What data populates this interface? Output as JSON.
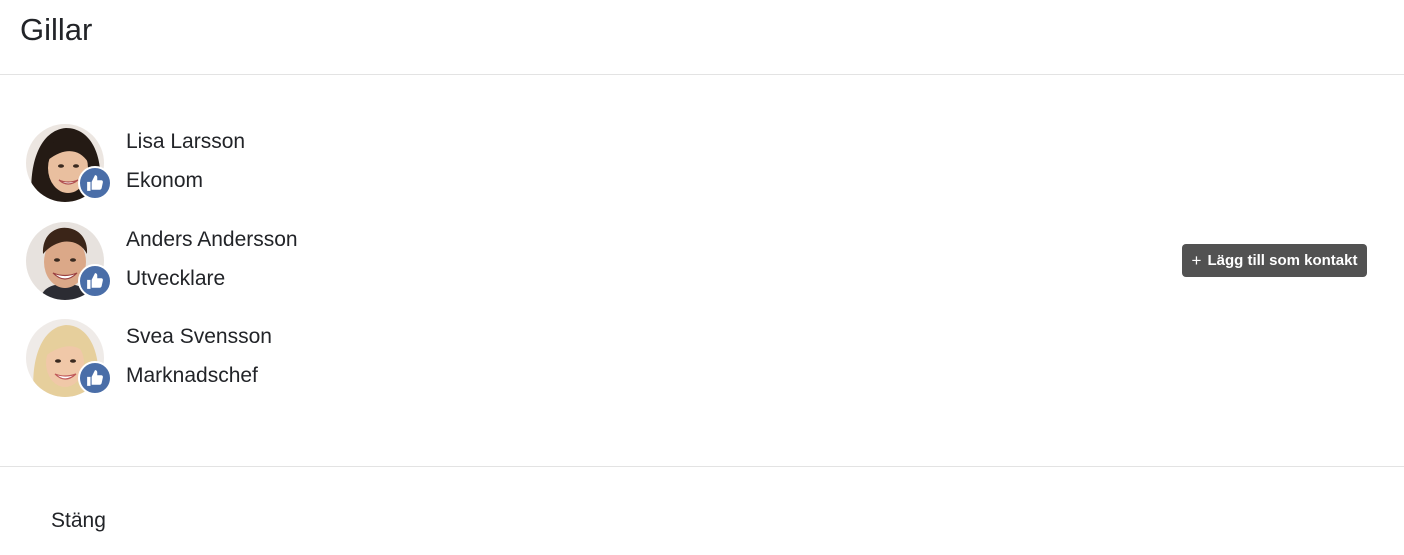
{
  "modal": {
    "title": "Gillar",
    "close_label": "Stäng"
  },
  "likes": [
    {
      "name": "Lisa Larsson",
      "title": "Ekonom",
      "avatar": "woman-dark-hair-photo",
      "badge_icon": "thumbs-up-icon"
    },
    {
      "name": "Anders Andersson",
      "title": "Utvecklare",
      "avatar": "man-smiling-photo",
      "badge_icon": "thumbs-up-icon"
    },
    {
      "name": "Svea Svensson",
      "title": "Marknadschef",
      "avatar": "woman-blonde-photo",
      "badge_icon": "thumbs-up-icon"
    }
  ],
  "add_contact": {
    "label": "Lägg till som kontakt",
    "icon": "plus-icon"
  },
  "colors": {
    "like_badge": "#4a6ea8",
    "add_contact_button": "#525252",
    "text": "#222428",
    "divider": "#e3e3e3"
  }
}
